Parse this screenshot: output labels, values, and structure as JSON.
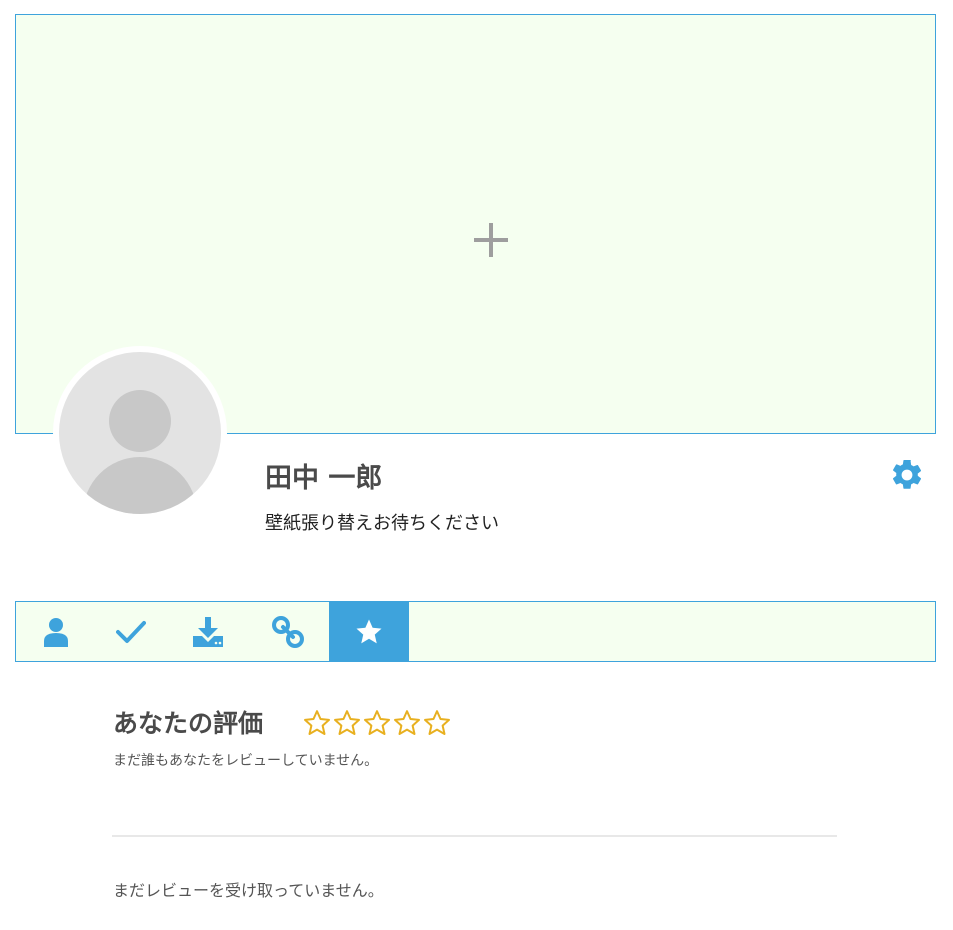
{
  "cover": {
    "add_icon": "plus-icon"
  },
  "profile": {
    "avatar_icon": "user-avatar-placeholder",
    "name": "田中 一郎",
    "status": "壁紙張り替えお待ちください",
    "settings_icon": "gear-icon"
  },
  "tabs": [
    {
      "icon": "user-icon",
      "active": false
    },
    {
      "icon": "check-icon",
      "active": false
    },
    {
      "icon": "download-icon",
      "active": false
    },
    {
      "icon": "link-icon",
      "active": false
    },
    {
      "icon": "star-icon",
      "active": true
    }
  ],
  "rating": {
    "title": "あなたの評価",
    "stars_filled": 0,
    "stars_total": 5,
    "no_reviews_text": "まだ誰もあなたをレビューしていません。"
  },
  "received": {
    "no_reviews_text": "まだレビューを受け取っていません。"
  },
  "colors": {
    "accent": "#3ea3dc",
    "cover_bg": "#f5fff0",
    "star": "#e8b020"
  }
}
